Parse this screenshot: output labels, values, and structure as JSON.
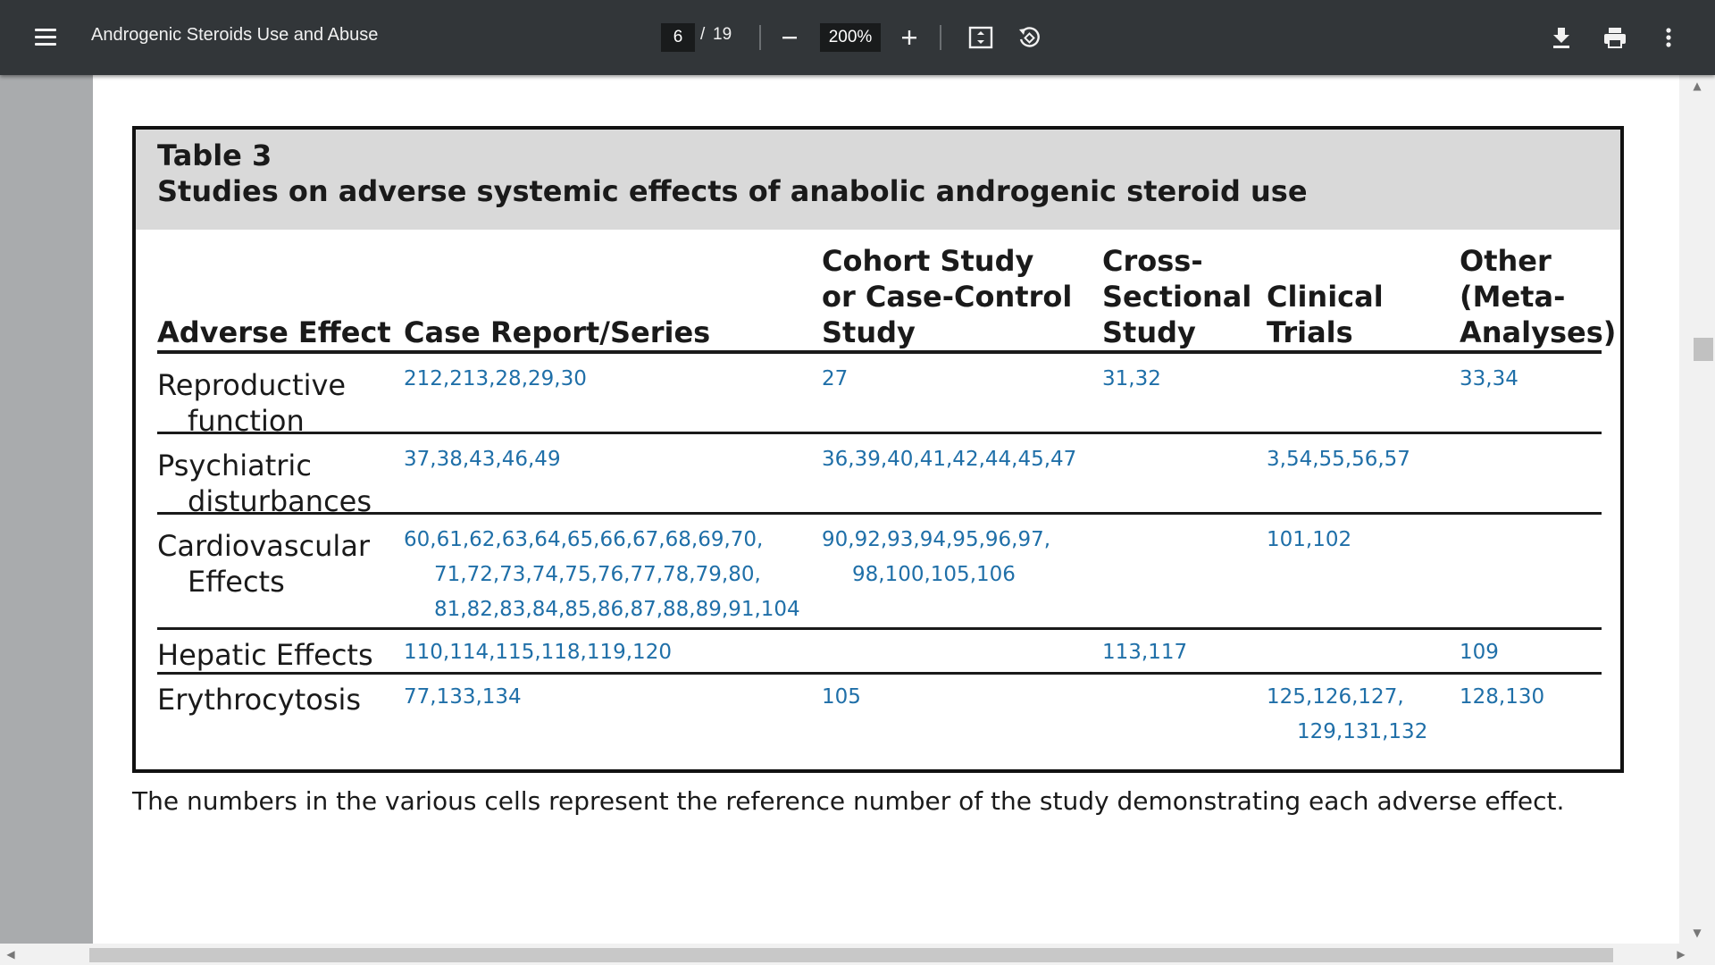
{
  "toolbar": {
    "title": "Androgenic Steroids Use and Abuse",
    "page_current": "6",
    "page_separator": "/",
    "page_total": "19",
    "zoom": "200%",
    "icons": [
      "menu-icon",
      "zoom-out-icon",
      "zoom-in-icon",
      "fit-page-icon",
      "rotate-icon",
      "download-icon",
      "print-icon",
      "more-icon"
    ]
  },
  "table": {
    "label": "Table 3",
    "caption": "Studies on adverse systemic effects of anabolic androgenic steroid use",
    "columns": {
      "effect": "Adverse Effect",
      "case": "Case Report/Series",
      "cohort_l1": "Cohort Study",
      "cohort_l2": "or Case-Control",
      "cohort_l3": "Study",
      "cross_l1": "Cross-",
      "cross_l2": "Sectional",
      "cross_l3": "Study",
      "clin_l1": "Clinical",
      "clin_l2": "Trials",
      "other_l1": "Other",
      "other_l2": "(Meta-",
      "other_l3": "Analyses)"
    },
    "rows": {
      "reproductive": {
        "effect_l1": "Reproductive",
        "effect_l2": "function",
        "case": "212,213,28,29,30",
        "cohort": "27",
        "cross": "31,32",
        "other": "33,34"
      },
      "psychiatric": {
        "effect_l1": "Psychiatric",
        "effect_l2": "disturbances",
        "case": "37,38,43,46,49",
        "cohort": "36,39,40,41,42,44,45,47",
        "clinical": "3,54,55,56,57"
      },
      "cardio": {
        "effect_l1": "Cardiovascular",
        "effect_l2": "Effects",
        "case_l1": "60,61,62,63,64,65,66,67,68,69,70,",
        "case_l2": "71,72,73,74,75,76,77,78,79,80,",
        "case_l3": "81,82,83,84,85,86,87,88,89,91,104",
        "cohort_l1": "90,92,93,94,95,96,97,",
        "cohort_l2": "98,100,105,106",
        "clinical": "101,102"
      },
      "hepatic": {
        "effect": "Hepatic Effects",
        "case": "110,114,115,118,119,120",
        "cross": "113,117",
        "other": "109"
      },
      "erythro": {
        "effect": "Erythrocytosis",
        "case": "77,133,134",
        "cohort": "105",
        "clinical_l1": "125,126,127,",
        "clinical_l2": "129,131,132",
        "other": "128,130"
      }
    },
    "footnote": "The numbers in the various cells represent the reference number of the study demonstrating each adverse effect."
  }
}
